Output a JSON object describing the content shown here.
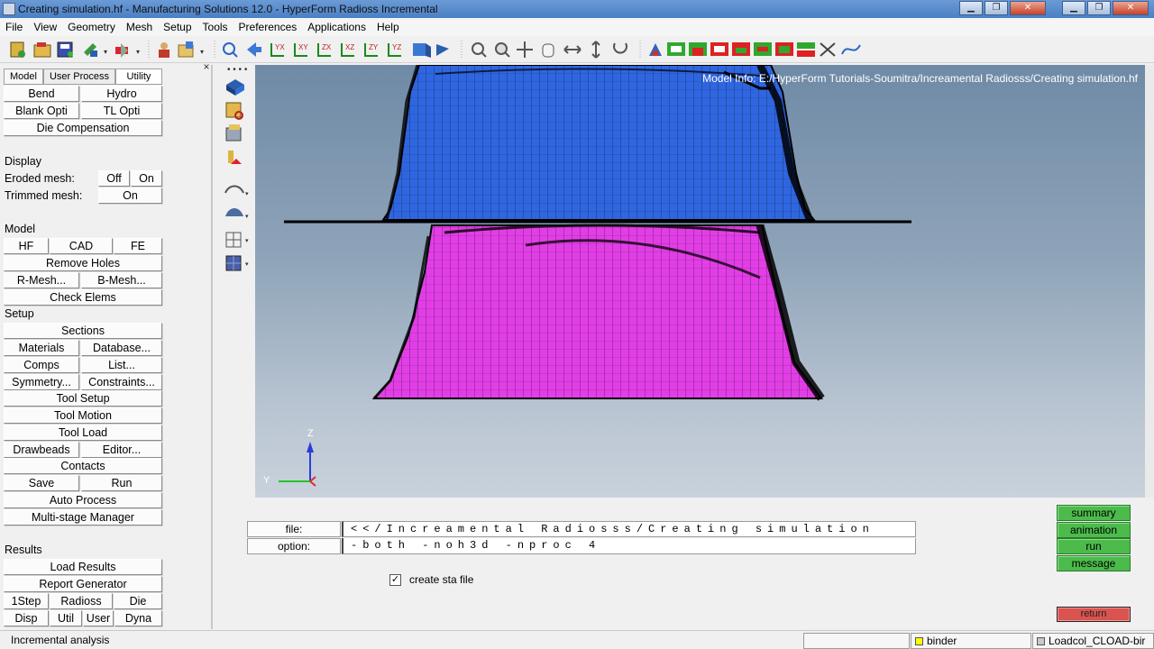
{
  "window": {
    "title": "Creating simulation.hf - Manufacturing Solutions 12.0 - HyperForm Radioss Incremental",
    "controls": [
      "minimize-icon",
      "restore-icon",
      "close-icon",
      "minimize-icon",
      "restore-icon",
      "close-icon"
    ]
  },
  "menu": [
    "File",
    "View",
    "Geometry",
    "Mesh",
    "Setup",
    "Tools",
    "Preferences",
    "Applications",
    "Help"
  ],
  "left_panel": {
    "tabs": [
      "Model",
      "User Process",
      "Utility"
    ],
    "close": "×",
    "buttons": {
      "bend": "Bend",
      "hydro": "Hydro",
      "blank_opti": "Blank Opti",
      "tl_opti": "TL Opti",
      "die_comp": "Die Compensation"
    },
    "display": {
      "heading": "Display",
      "eroded": "Eroded mesh:",
      "eroded_off": "Off",
      "eroded_on": "On",
      "trimmed": "Trimmed mesh:",
      "trimmed_on": "On"
    },
    "model": {
      "heading": "Model",
      "hf": "HF",
      "cad": "CAD",
      "fe": "FE",
      "remove_holes": "Remove Holes",
      "r_mesh": "R-Mesh...",
      "b_mesh": "B-Mesh...",
      "check_elems": "Check Elems"
    },
    "setup": {
      "heading": "Setup",
      "sections": "Sections",
      "materials": "Materials",
      "database": "Database...",
      "comps": "Comps",
      "list": "List...",
      "symmetry": "Symmetry...",
      "constraints": "Constraints...",
      "tool_setup": "Tool Setup",
      "tool_motion": "Tool Motion",
      "tool_load": "Tool Load",
      "drawbeads": "Drawbeads",
      "editor": "Editor...",
      "contacts": "Contacts",
      "save": "Save",
      "run": "Run",
      "auto_process": "Auto Process",
      "multistage": "Multi-stage Manager"
    },
    "results": {
      "heading": "Results",
      "load_results": "Load Results",
      "report_gen": "Report Generator",
      "step1": "1Step",
      "radioss": "Radioss",
      "die": "Die",
      "disp": "Disp",
      "util": "Util",
      "user": "User",
      "dyna": "Dyna"
    }
  },
  "viewport": {
    "model_info": "Model Info: E:/HyperForm Tutorials-Soumitra/Increamental Radiosss/Creating simulation.hf",
    "axis_z": "Z",
    "axis_y": "Y",
    "colors": {
      "upper_part": "#2f66e0",
      "lower_part": "#e23ee6",
      "mesh_line": "#000000"
    }
  },
  "bottom_panel": {
    "file_label": "file:",
    "file_value": "<</Increamental Radiosss/Creating simulation",
    "option_label": "option:",
    "option_value": "-both -noh3d -nproc 4",
    "create_sta_label": "create sta file",
    "create_sta_checked": "✓",
    "buttons": [
      "summary",
      "animation",
      "run",
      "message"
    ],
    "return": "return"
  },
  "status_bar": {
    "message": "Incremental analysis",
    "comp1": "binder",
    "comp1_color": "#ffff00",
    "comp2": "Loadcol_CLOAD-bir",
    "comp2_color": "#c8c8c8"
  }
}
